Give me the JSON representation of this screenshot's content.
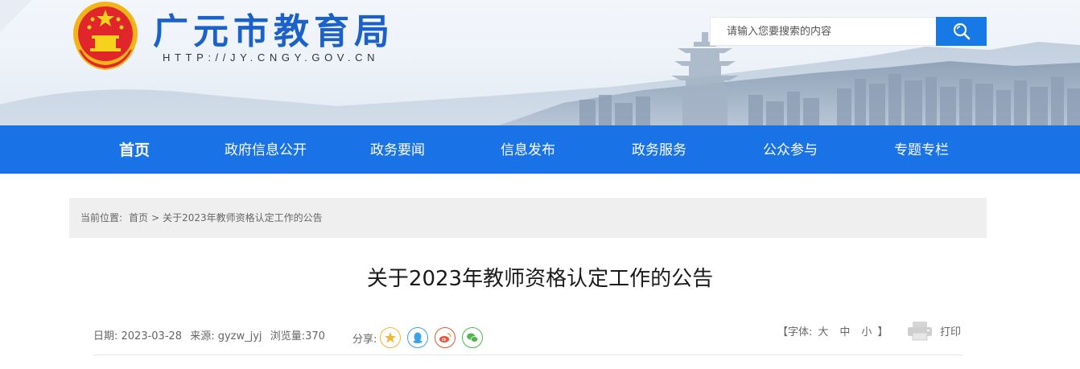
{
  "header": {
    "site_name": "广元市教育局",
    "site_url": "HTTP://JY.CNGY.GOV.CN",
    "emblem_icon": "national-emblem-icon",
    "search": {
      "placeholder": "请输入您要搜索的内容",
      "value": "",
      "button_icon": "search-icon"
    }
  },
  "nav": {
    "items": [
      {
        "label": "首页",
        "active": true
      },
      {
        "label": "政府信息公开"
      },
      {
        "label": "政务要闻"
      },
      {
        "label": "信息发布"
      },
      {
        "label": "政务服务"
      },
      {
        "label": "公众参与"
      },
      {
        "label": "专题专栏"
      }
    ]
  },
  "breadcrumb": {
    "label": "当前位置:",
    "items": [
      "首页",
      "关于2023年教师资格认定工作的公告"
    ],
    "separator": ">"
  },
  "article": {
    "title": "关于2023年教师资格认定工作的公告",
    "date": "日期: 2023-03-28",
    "source": "来源: gyzw_jyj",
    "views": "浏览量:370",
    "share_label": "分享:",
    "share_icons": [
      "qzone-star-icon",
      "qq-penguin-icon",
      "weibo-icon",
      "wechat-icon"
    ],
    "font_label": "【字体:",
    "font_sizes": [
      "大",
      "中",
      "小"
    ],
    "font_close": "】",
    "print_label": "打印",
    "print_icon": "printer-icon"
  },
  "colors": {
    "nav_bg": "#1a73e6",
    "search_button": "#1679e5",
    "site_name": "#1a62c9",
    "breadcrumb_bg": "#efefef",
    "share_qzone": "#f4b63a",
    "share_qq": "#3aa3e8",
    "share_weibo": "#e8533a",
    "share_wechat": "#4cb848"
  }
}
